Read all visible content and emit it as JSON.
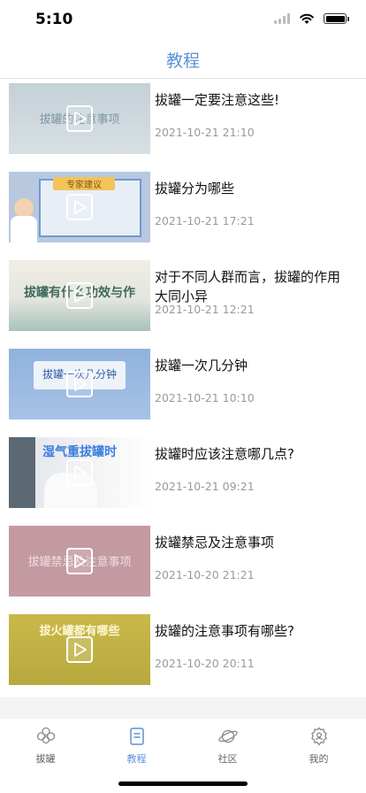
{
  "status_bar": {
    "time": "5:10"
  },
  "nav": {
    "title": "教程"
  },
  "videos": [
    {
      "title": "拔罐一定要注意这些!",
      "date": "2021-10-21 21:10",
      "thumb_caption": "拔罐的注意事项"
    },
    {
      "title": "拔罐分为哪些",
      "date": "2021-10-21 17:21",
      "thumb_caption": "专家建议"
    },
    {
      "title": "对于不同人群而言，拔罐的作用大同小异",
      "date": "2021-10-21 12:21",
      "thumb_caption": "拔罐有什么功效与作"
    },
    {
      "title": "拔罐一次几分钟",
      "date": "2021-10-21 10:10",
      "thumb_caption": "拔罐一次几分钟"
    },
    {
      "title": "拔罐时应该注意哪几点?",
      "date": "2021-10-21 09:21",
      "thumb_caption": "湿气重拔罐时"
    },
    {
      "title": "拔罐禁忌及注意事项",
      "date": "2021-10-20 21:21",
      "thumb_caption": "拔罐禁忌及注意事项"
    },
    {
      "title": "拔罐的注意事项有哪些?",
      "date": "2021-10-20 20:11",
      "thumb_caption": "拔火罐都有哪些"
    }
  ],
  "tabs": [
    {
      "label": "拔罐",
      "icon": "flower-icon",
      "active": false
    },
    {
      "label": "教程",
      "icon": "book-icon",
      "active": true
    },
    {
      "label": "社区",
      "icon": "planet-icon",
      "active": false
    },
    {
      "label": "我的",
      "icon": "user-gear-icon",
      "active": false
    }
  ],
  "colors": {
    "accent": "#5b93d8",
    "inactive": "#666666",
    "date": "#9a9a9a"
  }
}
